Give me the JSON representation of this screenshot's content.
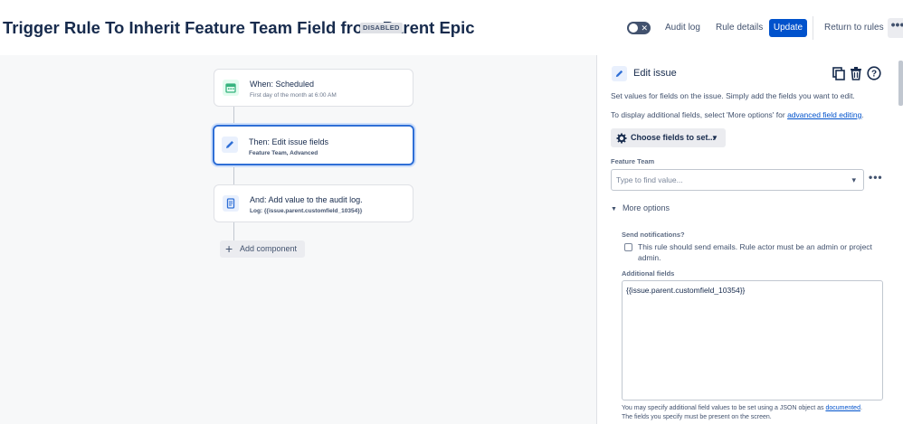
{
  "header": {
    "title": "Trigger Rule To Inherit Feature Team Field from Parent Epic",
    "status_badge": "DISABLED",
    "toggle_icon": "x-icon",
    "audit_log": "Audit log",
    "rule_details": "Rule details",
    "update": "Update",
    "return_to_rules": "Return to rules",
    "more": "•••"
  },
  "flow": {
    "nodes": [
      {
        "title": "When: Scheduled",
        "subtitle": "First day of the month at 6:00 AM",
        "icon": "calendar-icon",
        "color": "#36b37e"
      },
      {
        "title": "Then: Edit issue fields",
        "subtitle": "Feature Team, Advanced",
        "icon": "pencil-icon",
        "color": "#2f6fd6"
      },
      {
        "title": "And: Add value to the audit log.",
        "subtitle": "Log: {{issue.parent.customfield_10354}}",
        "icon": "document-icon",
        "color": "#2f6fd6"
      }
    ],
    "add_component": "Add component"
  },
  "panel": {
    "title": "Edit issue",
    "desc1": "Set values for fields on the issue. Simply add the fields you want to edit.",
    "desc2_prefix": "To display additional fields, select 'More options' for ",
    "desc2_link": "advanced field editing",
    "desc2_suffix": ".",
    "choose_fields": "Choose fields to set...",
    "feature_team_label": "Feature Team",
    "feature_team_placeholder": "Type to find value...",
    "more_options": "More options",
    "send_notifications_label": "Send notifications?",
    "send_notifications_text": "This rule should send emails. Rule actor must be an admin or project admin.",
    "additional_fields_label": "Additional fields",
    "additional_fields_value": "{{issue.parent.customfield_10354}}",
    "help_prefix": "You may specify additional field values to be set using a JSON object as ",
    "help_link": "documented",
    "help_suffix": ".",
    "help_line2": "The fields you specify must be present on the screen."
  }
}
